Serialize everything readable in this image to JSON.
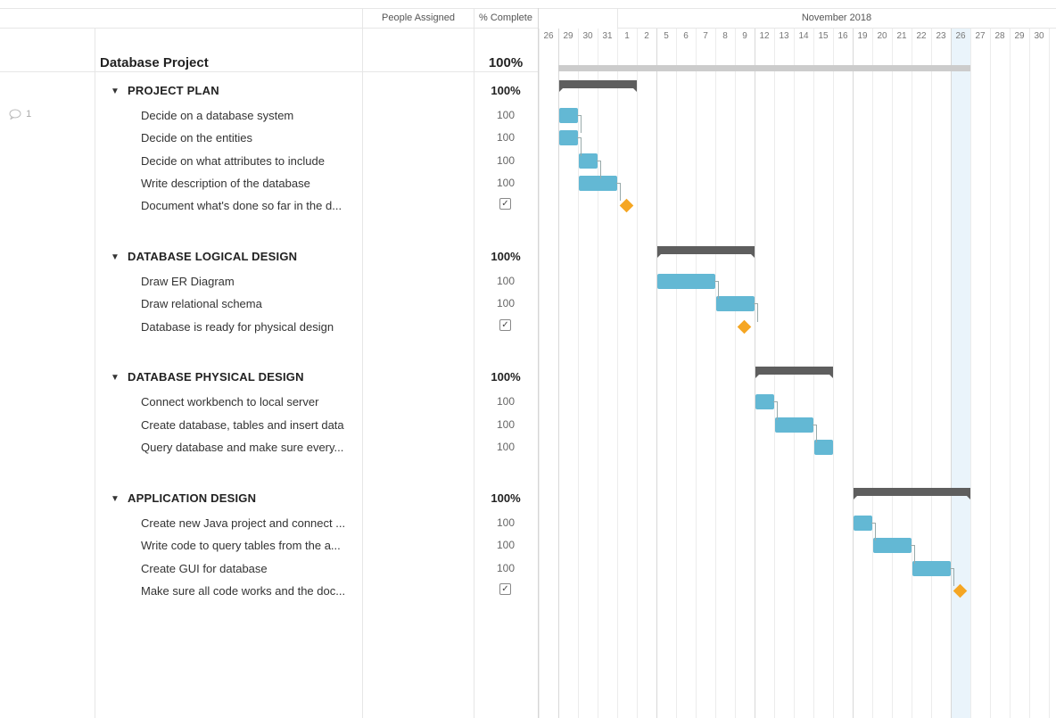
{
  "header": {
    "people_assigned": "People Assigned",
    "pct_complete": "% Complete",
    "month": "November 2018"
  },
  "days": [
    "26",
    "29",
    "30",
    "31",
    "1",
    "2",
    "5",
    "6",
    "7",
    "8",
    "9",
    "12",
    "13",
    "14",
    "15",
    "16",
    "19",
    "20",
    "21",
    "22",
    "23",
    "26",
    "27",
    "28",
    "29",
    "30"
  ],
  "today_day": "26",
  "comment": {
    "count": "1"
  },
  "project": {
    "name": "Database Project",
    "pct": "100%"
  },
  "groups": [
    {
      "name": "PROJECT PLAN",
      "pct": "100%",
      "tasks": [
        {
          "name": "Decide on a database system",
          "pct": "100"
        },
        {
          "name": "Decide on the entities",
          "pct": "100"
        },
        {
          "name": "Decide on what attributes to include",
          "pct": "100"
        },
        {
          "name": "Write description of the database",
          "pct": "100"
        },
        {
          "name": "Document what's done so far in the d...",
          "pct": "checked"
        }
      ]
    },
    {
      "name": "DATABASE LOGICAL DESIGN",
      "pct": "100%",
      "tasks": [
        {
          "name": "Draw ER Diagram",
          "pct": "100"
        },
        {
          "name": "Draw relational schema",
          "pct": "100"
        },
        {
          "name": "Database is ready for physical design",
          "pct": "checked"
        }
      ]
    },
    {
      "name": "DATABASE PHYSICAL DESIGN",
      "pct": "100%",
      "tasks": [
        {
          "name": "Connect workbench to local server",
          "pct": "100"
        },
        {
          "name": "Create database, tables and insert data",
          "pct": "100"
        },
        {
          "name": "Query database and make sure every...",
          "pct": "100"
        }
      ]
    },
    {
      "name": "APPLICATION DESIGN",
      "pct": "100%",
      "tasks": [
        {
          "name": "Create new Java project and connect ...",
          "pct": "100"
        },
        {
          "name": "Write code to query tables from the a...",
          "pct": "100"
        },
        {
          "name": "Create GUI for database",
          "pct": "100"
        },
        {
          "name": "Make sure all code works and the doc...",
          "pct": "checked"
        }
      ]
    }
  ],
  "colors": {
    "task_bar": "#63b8d4",
    "summary_bar": "#5e5e5e",
    "milestone": "#f5a623",
    "project_bar": "#cccccc",
    "today": "#eaf4fb"
  }
}
